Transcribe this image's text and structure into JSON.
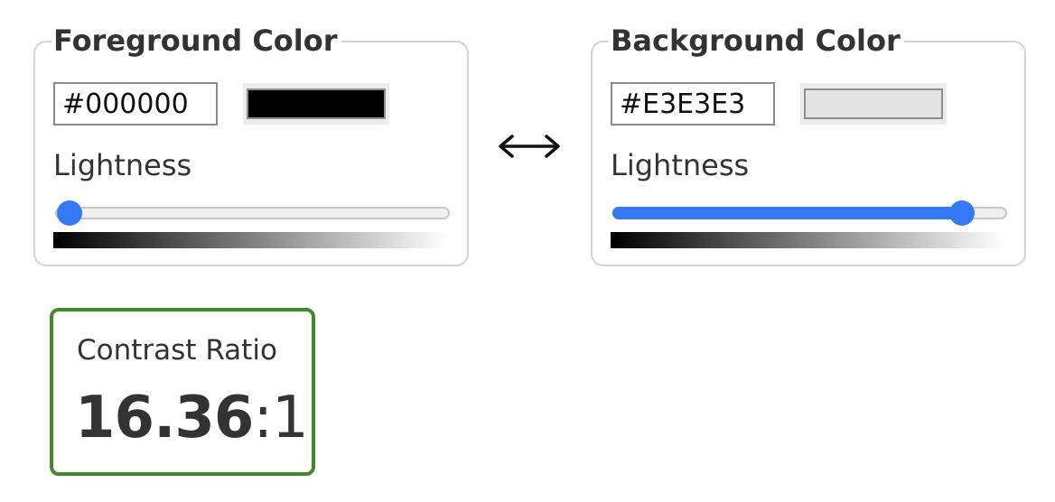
{
  "foreground": {
    "legend": "Foreground Color",
    "hex_value": "#000000",
    "swatch_color": "#000000",
    "lightness_label": "Lightness",
    "lightness_percent": 0
  },
  "background": {
    "legend": "Background Color",
    "hex_value": "#E3E3E3",
    "swatch_color": "#E3E3E3",
    "lightness_label": "Lightness",
    "lightness_percent": 89
  },
  "swap": {
    "icon": "left-right-arrow-icon"
  },
  "result": {
    "label": "Contrast Ratio",
    "ratio": "16.36",
    "suffix": ":1",
    "border_color": "#3F8A2A"
  },
  "colors": {
    "accent": "#3478F6",
    "panel_border": "#D3D3D3",
    "text": "#333333"
  }
}
